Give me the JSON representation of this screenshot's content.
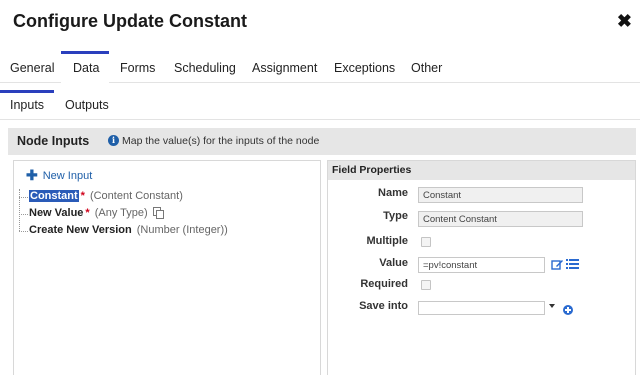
{
  "dialog": {
    "title": "Configure Update Constant",
    "close_glyph": "✖"
  },
  "tabs": [
    {
      "label": "General",
      "active": false
    },
    {
      "label": "Data",
      "active": true
    },
    {
      "label": "Forms",
      "active": false
    },
    {
      "label": "Scheduling",
      "active": false
    },
    {
      "label": "Assignment",
      "active": false
    },
    {
      "label": "Exceptions",
      "active": false
    },
    {
      "label": "Other",
      "active": false
    }
  ],
  "subtabs": [
    {
      "label": "Inputs",
      "active": true
    },
    {
      "label": "Outputs",
      "active": false
    }
  ],
  "node_inputs": {
    "title": "Node Inputs",
    "info_icon_glyph": "i",
    "info_text": "Map the value(s) for the inputs of the node"
  },
  "inputs_tree": {
    "new_input_label": "New Input",
    "plus_glyph": "✚",
    "items": [
      {
        "name": "Constant",
        "required_mark": "*",
        "type": "(Content Constant)",
        "selected": true
      },
      {
        "name": "New Value",
        "required_mark": "*",
        "type": "(Any Type)",
        "selected": false
      },
      {
        "name": "Create New Version",
        "required_mark": "",
        "type": "(Number (Integer))",
        "selected": false
      }
    ]
  },
  "field_properties": {
    "title": "Field Properties",
    "name_label": "Name",
    "name_value": "Constant",
    "type_label": "Type",
    "type_value": "Content Constant",
    "multiple_label": "Multiple",
    "multiple_checked": false,
    "value_label": "Value",
    "value_value": "=pv!constant",
    "required_label": "Required",
    "required_checked": false,
    "save_into_label": "Save into",
    "save_into_value": ""
  },
  "colors": {
    "accent": "#2a3fbd",
    "link": "#1f5fa8",
    "selection": "#2a5bb8",
    "required": "#d0021b",
    "header_bg": "#e6e6e6"
  },
  "icons": [
    "close-icon",
    "info-icon",
    "plus-icon",
    "copy-icon",
    "edit-icon",
    "list-icon",
    "chevron-down-icon",
    "add-circle-icon"
  ]
}
